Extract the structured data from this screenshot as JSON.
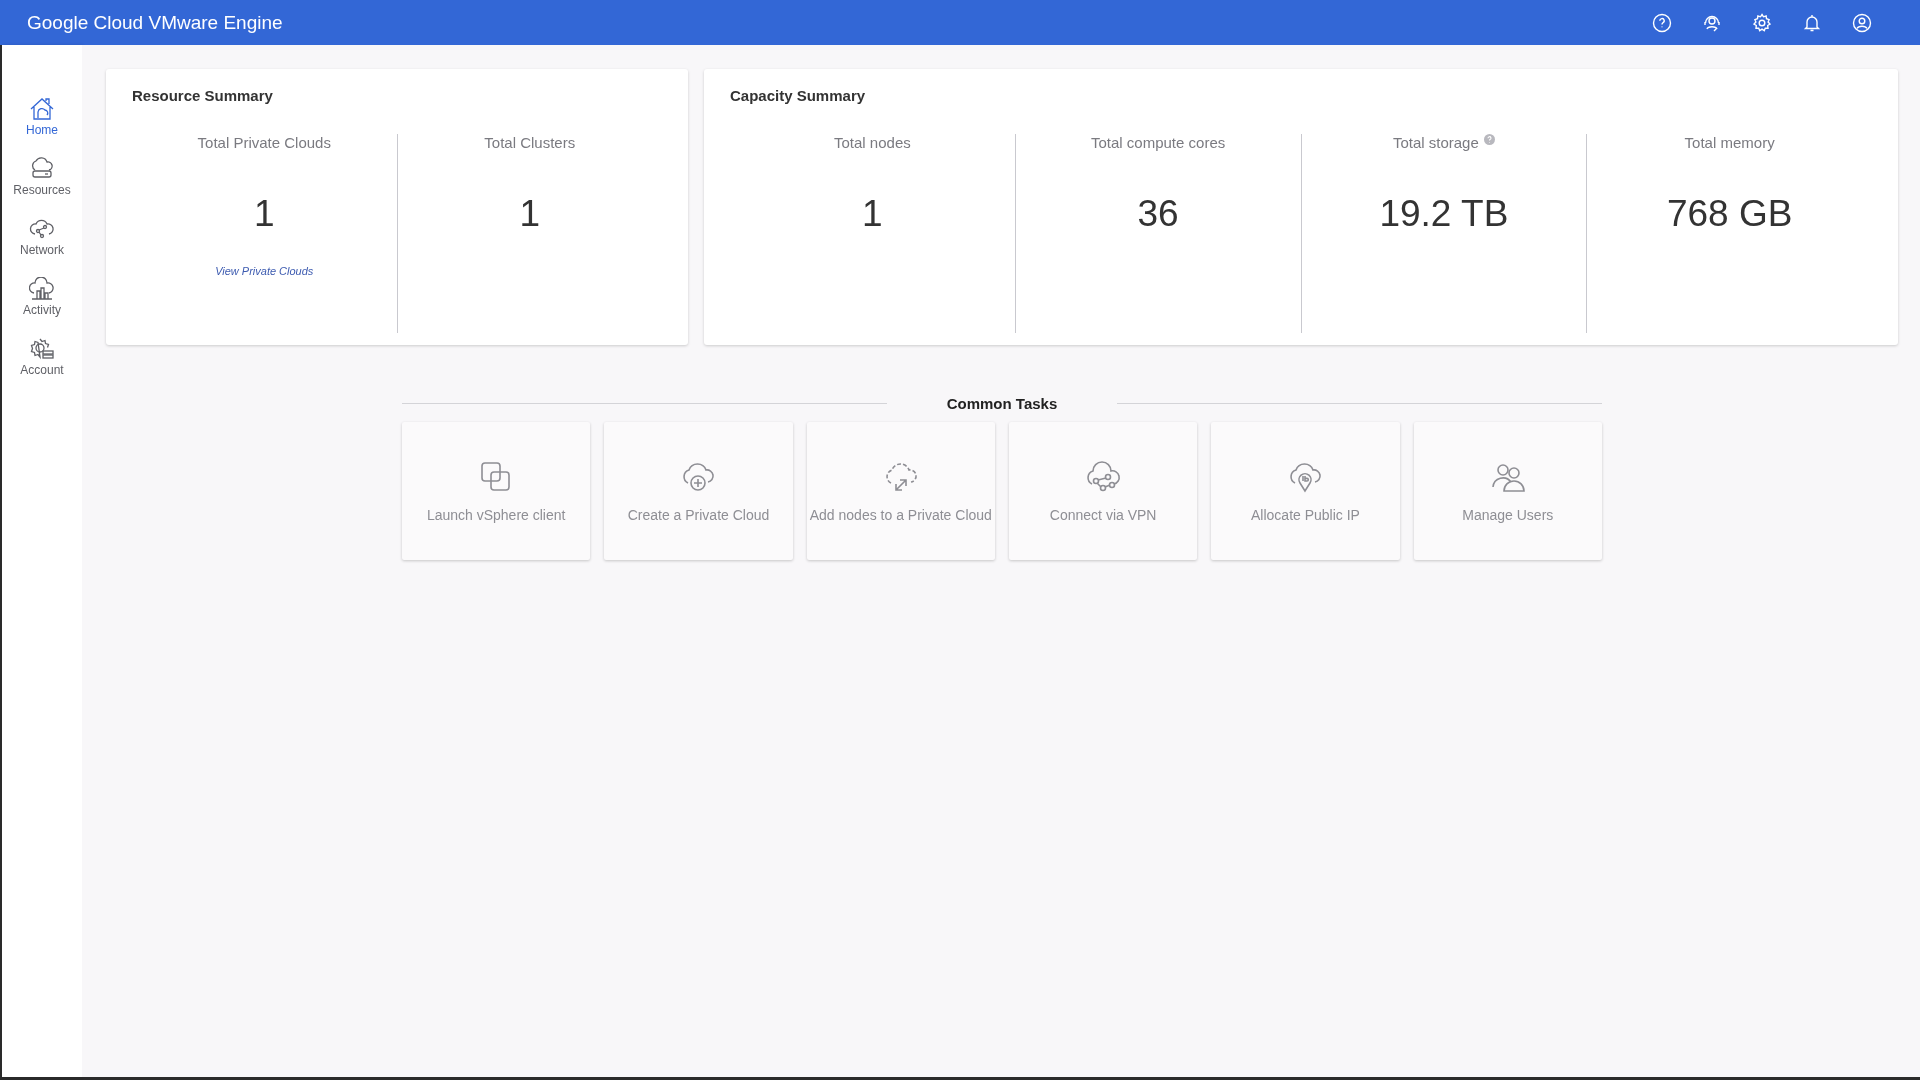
{
  "app_bar": {
    "title": "Google Cloud VMware Engine"
  },
  "sidebar": {
    "items": [
      {
        "label": "Home",
        "selected": true
      },
      {
        "label": "Resources",
        "selected": false
      },
      {
        "label": "Network",
        "selected": false
      },
      {
        "label": "Activity",
        "selected": false
      },
      {
        "label": "Account",
        "selected": false
      }
    ]
  },
  "resource_summary": {
    "title": "Resource Summary",
    "stats": [
      {
        "label": "Total Private Clouds",
        "value": "1",
        "link": "View Private Clouds"
      },
      {
        "label": "Total Clusters",
        "value": "1"
      }
    ]
  },
  "capacity_summary": {
    "title": "Capacity Summary",
    "stats": [
      {
        "label": "Total nodes",
        "value": "1",
        "help": false
      },
      {
        "label": "Total compute cores",
        "value": "36",
        "help": false
      },
      {
        "label": "Total storage",
        "value": "19.2 TB",
        "help": true
      },
      {
        "label": "Total memory",
        "value": "768 GB",
        "help": false
      }
    ]
  },
  "common_tasks": {
    "title": "Common Tasks",
    "tasks": [
      {
        "label": "Launch vSphere client"
      },
      {
        "label": "Create a Private Cloud"
      },
      {
        "label": "Add nodes to a Private Cloud"
      },
      {
        "label": "Connect via VPN"
      },
      {
        "label": "Allocate Public IP"
      },
      {
        "label": "Manage Users"
      }
    ]
  }
}
